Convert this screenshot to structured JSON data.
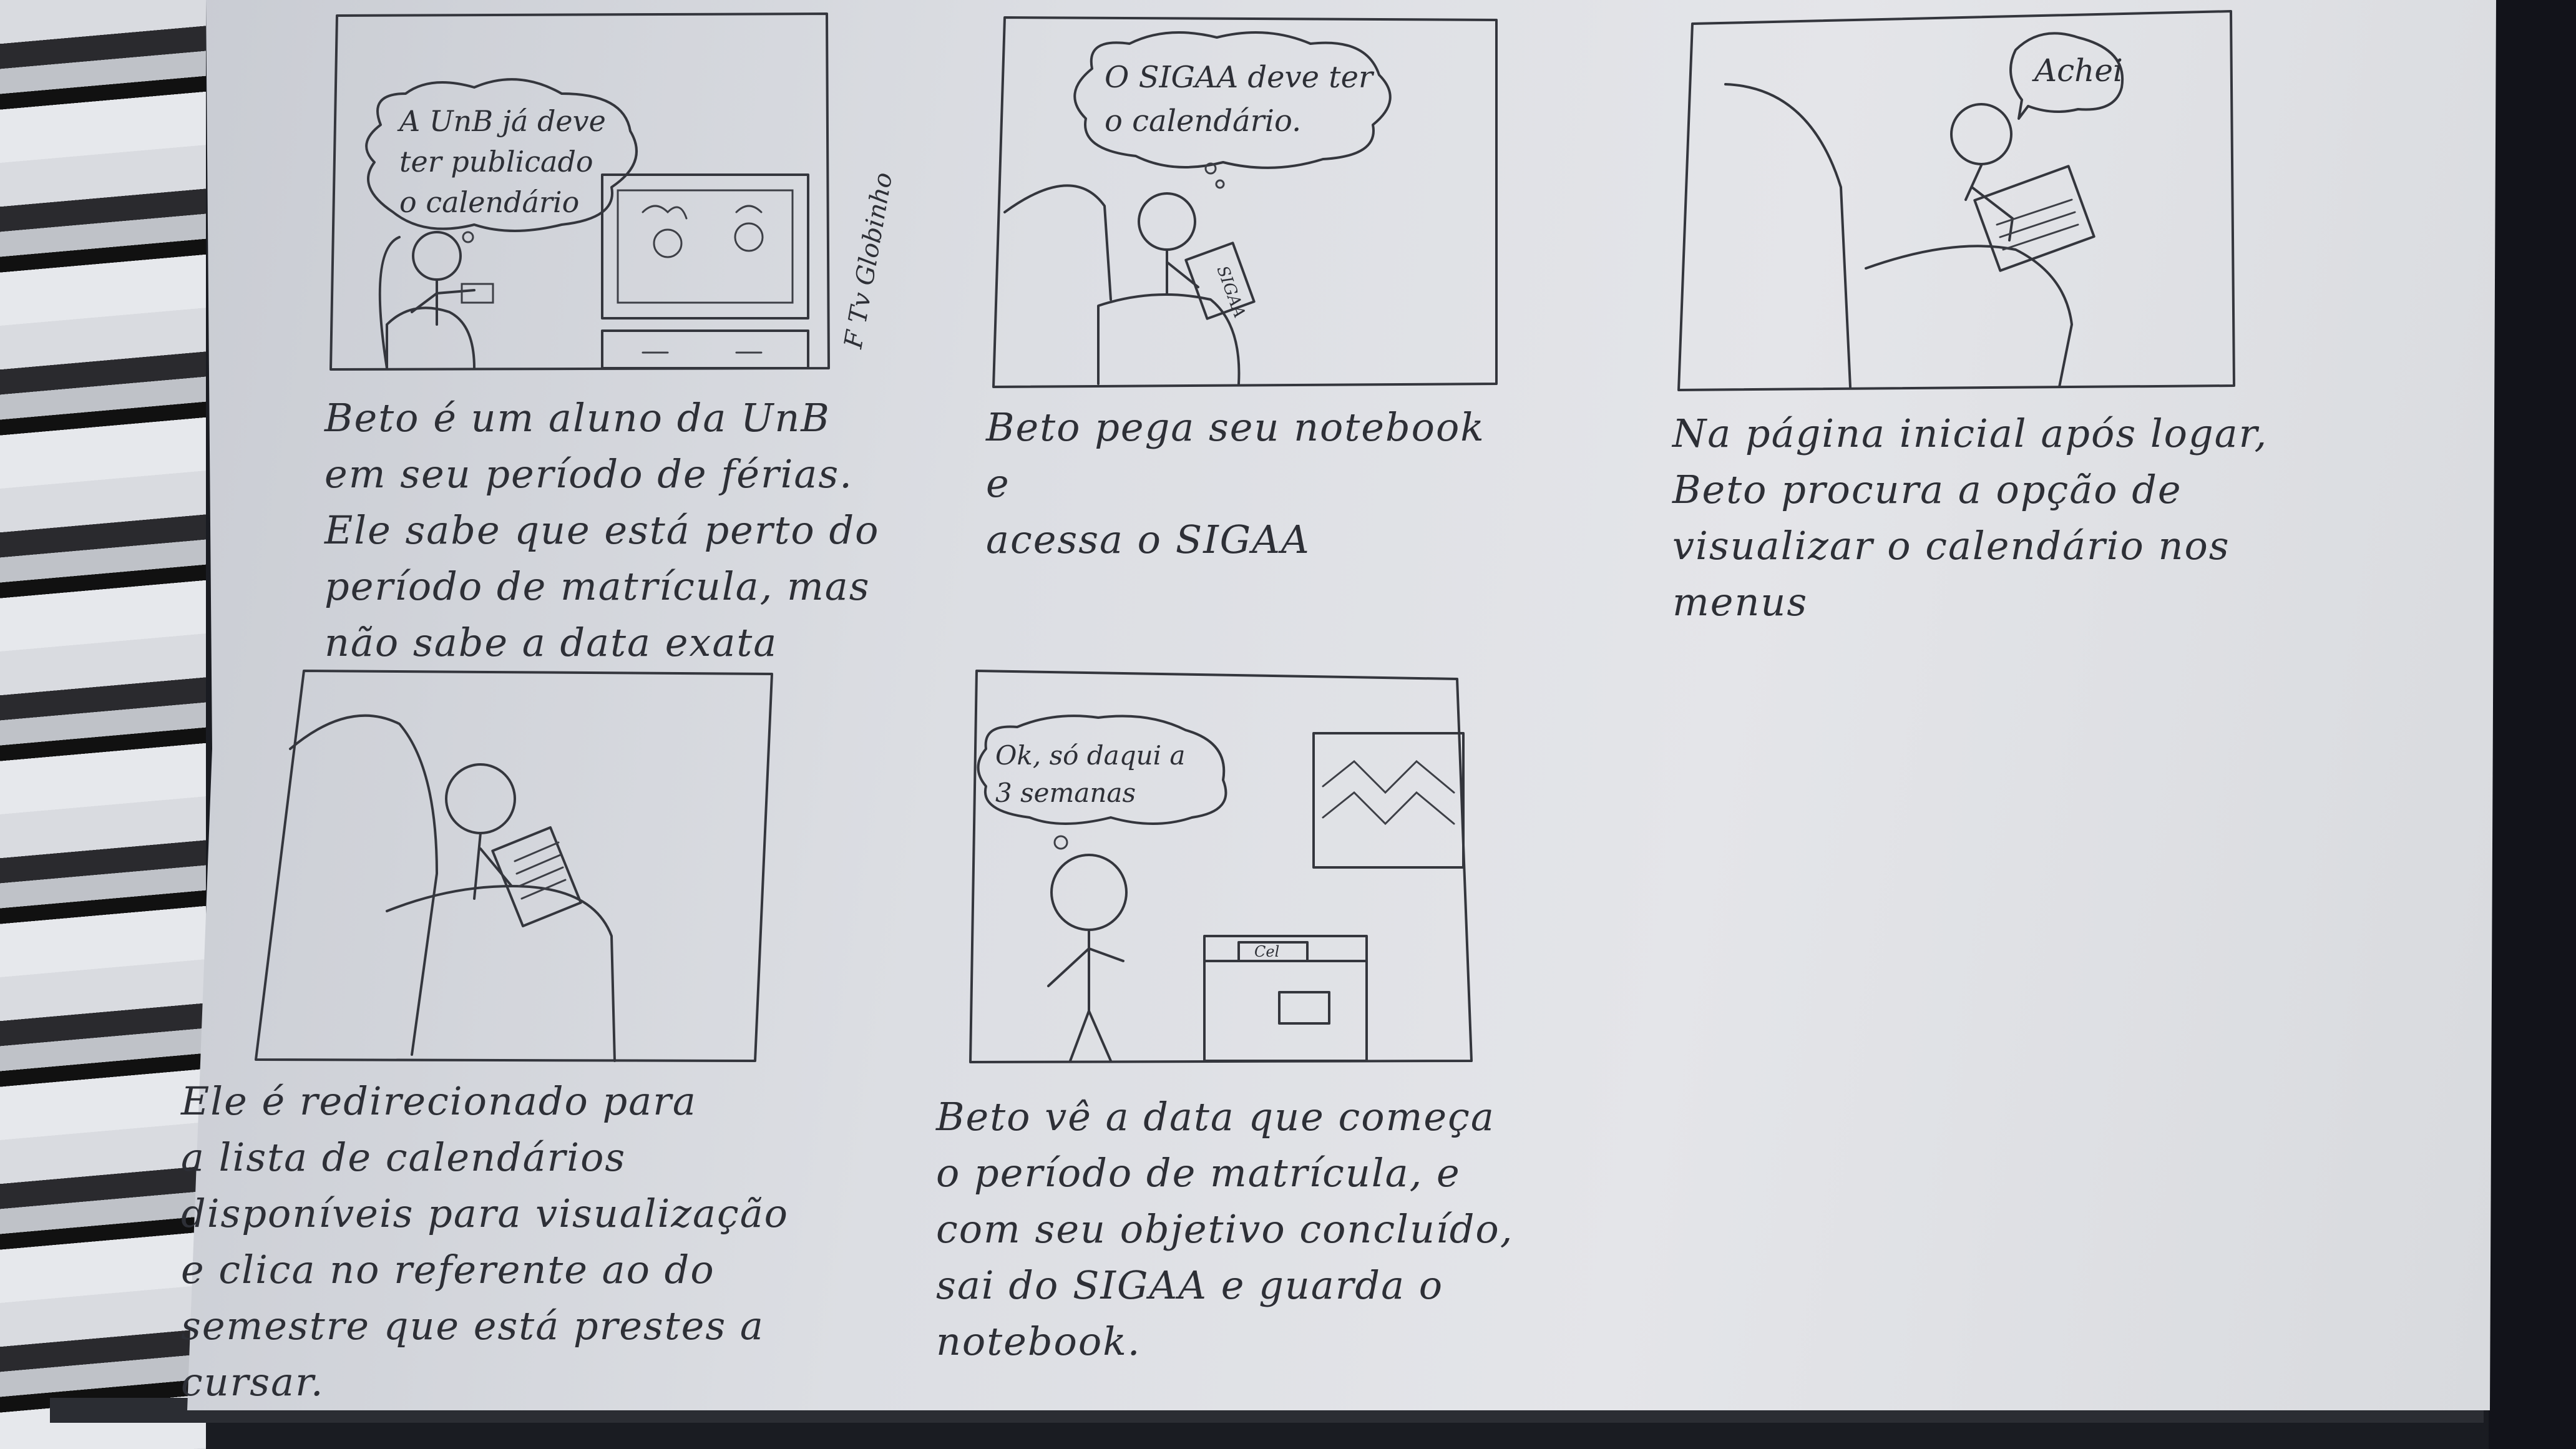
{
  "panels": [
    {
      "bubble": "A UnB já deve\nter publicado\no calendário",
      "tv_credit": "F Tv Globinho",
      "caption": "Beto é um aluno da UnB\nem seu período de férias.\nEle sabe que está perto do\nperíodo de matrícula, mas\nnão sabe a data exata"
    },
    {
      "bubble": "O SIGAA deve ter\no calendário.",
      "laptop_label": "SIGAA",
      "caption": "Beto pega seu notebook e\nacessa o SIGAA"
    },
    {
      "bubble": "Achei",
      "caption": "Na página inicial após logar,\nBeto procura a opção de\nvisualizar o calendário nos menus"
    },
    {
      "caption": "Ele é redirecionado para\na lista de calendários\ndisponíveis para visualização\ne clica no referente ao do\nsemestre que está prestes a cursar."
    },
    {
      "bubble": "Ok, só daqui a\n3 semanas",
      "laptop_label": "Cel",
      "caption": "Beto vê a data que começa\no período de matrícula, e\ncom seu objetivo concluído,\nsai do SIGAA e guarda o\nnotebook."
    }
  ]
}
